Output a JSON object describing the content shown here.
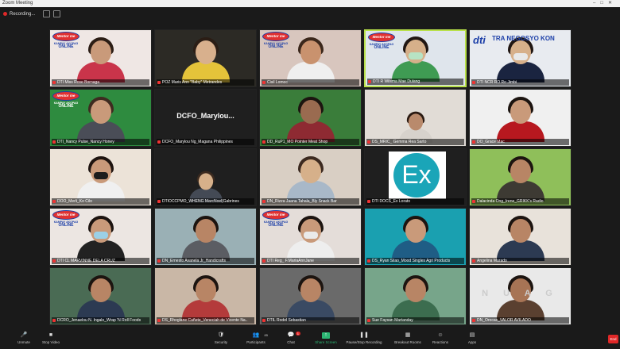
{
  "window": {
    "title": "Zoom Meeting",
    "controls": [
      "–",
      "□",
      "✕"
    ]
  },
  "topbar": {
    "recording_label": "Recording..."
  },
  "tiles": [
    {
      "name": "DTI Miss Rose Bornaga",
      "logo": true,
      "bg": "#efe7e4",
      "skin": "#c99a7a",
      "hair": "#2b1d15",
      "shirt": "#c9344a",
      "mask": ""
    },
    {
      "name": "POZ Maris Ann \"Baby\" Metrandes",
      "logo": false,
      "bg": "#2c2a25",
      "skin": "#d8b08d",
      "hair": "#2b1d15",
      "shirt": "#e4c33a",
      "mask": ""
    },
    {
      "name": "Cisil Lomoc",
      "logo": true,
      "bg": "#d8c6be",
      "skin": "#c9926e",
      "hair": "#3b271b",
      "shirt": "#efefef",
      "mask": ""
    },
    {
      "name": "DTI R Wilsma Mae Dulang",
      "logo": true,
      "bg": "#dfe5ec",
      "skin": "#d6b08a",
      "hair": "#201612",
      "shirt": "#3f9b53",
      "mask": "#b7e3c4",
      "active": true
    },
    {
      "name": "DTI NCR RO Ro Jimbi",
      "dti": true,
      "bg": "#e8ebf0",
      "skin": "#d7b08a",
      "hair": "#201612",
      "shirt": "#1a2440",
      "mask": "#e8e8e8"
    },
    {
      "name": "DTI_Nancy Pulse_Nancy Honey",
      "logo": true,
      "bg": "#2e8b3f",
      "skin": "#c99a7a",
      "hair": "#3e2b20",
      "shirt": "#4a4d57",
      "mask": "",
      "green": true
    },
    {
      "name": "DCFO_Marylou Ng_Magana Philippines",
      "text": "DCFO_Marylou...",
      "bg": "#1f1f1f"
    },
    {
      "name": "DD_RuP1_MO Pointer Meat Shop",
      "bg": "#3a7d3a",
      "skin": "#9a6b50",
      "hair": "#1c1510",
      "shirt": "#8e2a32",
      "mask": ""
    },
    {
      "name": "DS_MRIC_ Gemma Rea Sarto",
      "bg": "#e1dcd6",
      "skin": "#b98a6c",
      "hair": "#2a1a12",
      "shirt": "#d7d2cc",
      "mask": "",
      "small": true
    },
    {
      "name": "DO_Grace Mac",
      "bg": "#f0f0f0",
      "skin": "#c99a7a",
      "hair": "#1c1410",
      "shirt": "#b7181f",
      "mask": ""
    },
    {
      "name": "DOO_Merli_Ko Cilo",
      "bg": "#ece3d8",
      "skin": "#c99a7a",
      "hair": "#1e1410",
      "shirt": "#f0f0f0",
      "mask": "#1c1c1c"
    },
    {
      "name": "DTIOCCPMO_WHENG MarcNoel|Gabrines",
      "bg": "#1f1f1f",
      "skin": "#d6b08a",
      "hair": "#3b2a1f",
      "shirt": "#444a55",
      "mask": "",
      "small": true
    },
    {
      "name": "DN_Rizza Jaana Tahala_Bly Snack Bar",
      "bg": "#d9cfc4",
      "skin": "#d6b08a",
      "hair": "#3c2a20",
      "shirt": "#a8b8c8",
      "mask": ""
    },
    {
      "name": "DTI DOCS_Ex Lorato",
      "ex": true,
      "bg": "#1f1f1f"
    },
    {
      "name": "Dalacinda Ong_Irene_GRIKK's Radio",
      "bg": "#8fbf5a",
      "skin": "#b88565",
      "hair": "#1c1410",
      "shirt": "#3d3a33",
      "mask": ""
    },
    {
      "name": "DTI CL MARVINNE DELA CRUZ",
      "logo": true,
      "bg": "#ece6e2",
      "skin": "#c99a7a",
      "hair": "#1c1410",
      "shirt": "#222",
      "mask": "#9bd0e6"
    },
    {
      "name": "DN_Ernesto Avanela Jr_Handicrafts",
      "bg": "#9ab0b5",
      "skin": "#b88565",
      "hair": "#1c1410",
      "shirt": "#5b5d63",
      "mask": ""
    },
    {
      "name": "DTI Reg_ F.MariaAnnJane",
      "logo": true,
      "bg": "#e4ddd9",
      "skin": "#c99a7a",
      "hair": "#1c1410",
      "shirt": "#eee",
      "mask": "#eaeaea"
    },
    {
      "name": "DS_Ryan Silao_Mood Singles Agri Products",
      "bg": "#1aa0b0",
      "skin": "#c99a7a",
      "hair": "#1c1410",
      "shirt": "#1f5d85",
      "mask": ""
    },
    {
      "name": "Angelina Marado",
      "bg": "#e8e2da",
      "skin": "#b88565",
      "hair": "#1c1410",
      "shirt": "#2c3a52",
      "mask": ""
    },
    {
      "name": "DCRO_Jenaelou N. Ingalo_Wrap 'N Roll Foods",
      "bg": "#4a6b54",
      "skin": "#b88565",
      "hair": "#1c1410",
      "shirt": "#2c3a52",
      "mask": ""
    },
    {
      "name": "DS_Rhoglane Cañete_Veneciah de Vicente Na..",
      "bg": "#c9b7a6",
      "skin": "#b88565",
      "hair": "#1c1410",
      "shirt": "#b43b3b",
      "mask": ""
    },
    {
      "name": "DTIL Rodel Sebastian",
      "bg": "#6a6a6a",
      "skin": "#b88565",
      "hair": "#1c1410",
      "shirt": "#3a4a63",
      "mask": ""
    },
    {
      "name": "Sue Faysan Martanday",
      "bg": "#77a58a",
      "skin": "#b88565",
      "hair": "#1c1410",
      "shirt": "#3c6d4f",
      "mask": ""
    },
    {
      "name": "DN_Orocas_VALOR AVILADO",
      "bg": "#e9e9e9",
      "skin": "#a77455",
      "hair": "#1c1410",
      "shirt": "#5a4030",
      "mask": "",
      "nuag": "N U A G"
    }
  ],
  "logo": {
    "brand": "Mentor me",
    "line1": "KAMPAY AKOPAG",
    "line2": "ONLINE"
  },
  "dti": {
    "mark": "dti",
    "label": "TRA NEGOSYO KON"
  },
  "ex_logo": "Ex",
  "toolbar": {
    "items": [
      {
        "label": "Unmute",
        "icon": "🎤"
      },
      {
        "label": "Stop Video",
        "icon": "■"
      },
      {
        "label": "Security",
        "icon": "🛡"
      },
      {
        "label": "Participants",
        "icon": "👥",
        "count": "85"
      },
      {
        "label": "Chat",
        "icon": "💬",
        "badge": "1"
      },
      {
        "label": "Share Screen",
        "icon": "↑"
      },
      {
        "label": "Pause/Stop Recording",
        "icon": "❚❚"
      },
      {
        "label": "Breakout Rooms",
        "icon": "▦"
      },
      {
        "label": "Reactions",
        "icon": "☺"
      },
      {
        "label": "Apps",
        "icon": "▤"
      }
    ],
    "end_label": "End"
  }
}
